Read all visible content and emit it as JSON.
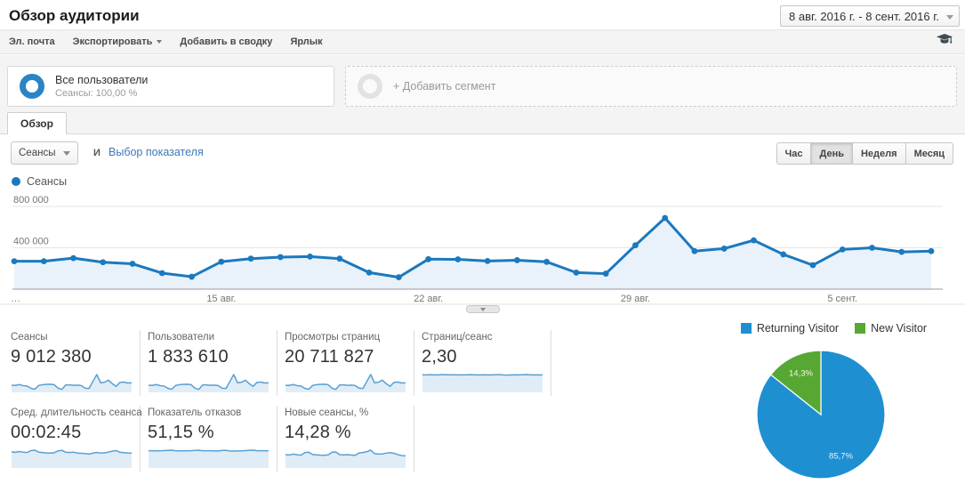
{
  "header": {
    "title": "Обзор аудитории",
    "date_range": "8 авг. 2016 г. - 8 сент. 2016 г."
  },
  "toolbar": {
    "items": [
      "Эл. почта",
      "Экспортировать",
      "Добавить в сводку",
      "Ярлык"
    ]
  },
  "segments": {
    "all_users": {
      "title": "Все пользователи",
      "subtitle": "Сеансы: 100,00 %"
    },
    "add_segment": {
      "label": "+ Добавить сегмент"
    }
  },
  "tab": {
    "label": "Обзор"
  },
  "controls": {
    "metric_select": "Сеансы",
    "and_label": "И",
    "compare_link": "Выбор показателя",
    "granularity": [
      "Час",
      "День",
      "Неделя",
      "Месяц"
    ],
    "active_granularity": "День"
  },
  "chart_legend": {
    "label": "Сеансы"
  },
  "colors": {
    "line_blue": "#1b79be",
    "area_fill": "#e9f2fa",
    "spark_line": "#5b9fd1",
    "spark_fill": "#e0edf7",
    "pie_blue": "#1e8fd1",
    "pie_green": "#57a832"
  },
  "chart_data": [
    {
      "type": "line",
      "title": "Сеансы по дням",
      "x_start": "8 авг. 2016",
      "x_end": "8 сент. 2016",
      "ylim": [
        0,
        800000
      ],
      "y_ticks": [
        {
          "v": 400000,
          "label": "400 000"
        },
        {
          "v": 800000,
          "label": "800 000"
        }
      ],
      "x_tick_labels": {
        "0": "…",
        "7": "15 авг.",
        "14": "22 авг.",
        "21": "29 авг.",
        "28": "5 сент."
      },
      "series": [
        {
          "name": "Сеансы",
          "values": [
            270000,
            270000,
            300000,
            260000,
            245000,
            155000,
            120000,
            265000,
            295000,
            310000,
            315000,
            295000,
            160000,
            115000,
            290000,
            288000,
            272000,
            280000,
            264000,
            160000,
            150000,
            424000,
            688000,
            368000,
            392000,
            472000,
            336000,
            232000,
            384000,
            400000,
            360000,
            368000
          ]
        }
      ]
    },
    {
      "type": "pie",
      "labels": [
        "Returning Visitor",
        "New Visitor"
      ],
      "values": [
        85.7,
        14.3
      ],
      "display_labels": [
        "85,7%",
        "14,3%"
      ],
      "colors": [
        "#1e8fd1",
        "#57a832"
      ],
      "legend_position": "top"
    }
  ],
  "metrics": {
    "row1": [
      {
        "label": "Сеансы",
        "value": "9 012 380",
        "spark": [
          270,
          270,
          300,
          260,
          245,
          155,
          120,
          265,
          295,
          310,
          315,
          295,
          160,
          115,
          290,
          288,
          272,
          280,
          264,
          160,
          150,
          424,
          688,
          368,
          392,
          472,
          336,
          232,
          384,
          400,
          360,
          368
        ]
      },
      {
        "label": "Пользователи",
        "value": "1 833 610",
        "spark": [
          270,
          270,
          300,
          260,
          245,
          155,
          120,
          265,
          295,
          310,
          315,
          295,
          160,
          115,
          290,
          288,
          272,
          280,
          264,
          160,
          150,
          424,
          688,
          368,
          392,
          472,
          336,
          232,
          384,
          400,
          360,
          368
        ]
      },
      {
        "label": "Просмотры страниц",
        "value": "20 711 827",
        "spark": [
          270,
          270,
          300,
          260,
          245,
          155,
          120,
          265,
          295,
          310,
          315,
          295,
          160,
          115,
          290,
          288,
          272,
          280,
          264,
          160,
          150,
          424,
          688,
          368,
          392,
          472,
          336,
          232,
          384,
          400,
          360,
          368
        ]
      },
      {
        "label": "Страниц/сеанс",
        "value": "2,30",
        "spark": [
          2.31,
          2.3,
          2.32,
          2.3,
          2.29,
          2.34,
          2.32,
          2.3,
          2.31,
          2.3,
          2.3,
          2.29,
          2.33,
          2.31,
          2.3,
          2.3,
          2.31,
          2.3,
          2.29,
          2.32,
          2.33,
          2.28,
          2.26,
          2.3,
          2.31,
          2.3,
          2.32,
          2.34,
          2.3,
          2.29,
          2.3,
          2.3
        ]
      }
    ],
    "row2": [
      {
        "label": "Сред. длительность сеанса",
        "value": "00:02:45",
        "spark": [
          165,
          160,
          168,
          162,
          158,
          178,
          182,
          162,
          158,
          154,
          152,
          156,
          175,
          180,
          160,
          158,
          162,
          152,
          150,
          148,
          142,
          152,
          158,
          152,
          155,
          162,
          172,
          178,
          160,
          157,
          154,
          152
        ]
      },
      {
        "label": "Показатель отказов",
        "value": "51,15 %",
        "spark": [
          51.2,
          51,
          50.8,
          51.1,
          51.3,
          52.1,
          52.4,
          51,
          50.8,
          50.6,
          50.9,
          51.1,
          52.2,
          52.5,
          51,
          50.9,
          51,
          50.6,
          50.4,
          51.9,
          52.1,
          50.4,
          50.1,
          50.3,
          50.7,
          51.4,
          52.3,
          52.7,
          51,
          50.9,
          51,
          51.1
        ]
      },
      {
        "label": "Новые сеансы, %",
        "value": "14,28 %",
        "spark": [
          13.6,
          13.2,
          14.1,
          13.5,
          13,
          15.6,
          16.1,
          13.7,
          13.3,
          13,
          12.9,
          13.3,
          15.9,
          16.3,
          13.5,
          13.3,
          13.6,
          13.1,
          12.9,
          15.3,
          15.7,
          16.6,
          18.1,
          14.6,
          14.1,
          14.3,
          15.1,
          15.6,
          14.9,
          13.6,
          12.6,
          12.3
        ]
      }
    ]
  },
  "pie_legend": [
    {
      "label": "Returning Visitor",
      "color": "#1e8fd1"
    },
    {
      "label": "New Visitor",
      "color": "#57a832"
    }
  ]
}
